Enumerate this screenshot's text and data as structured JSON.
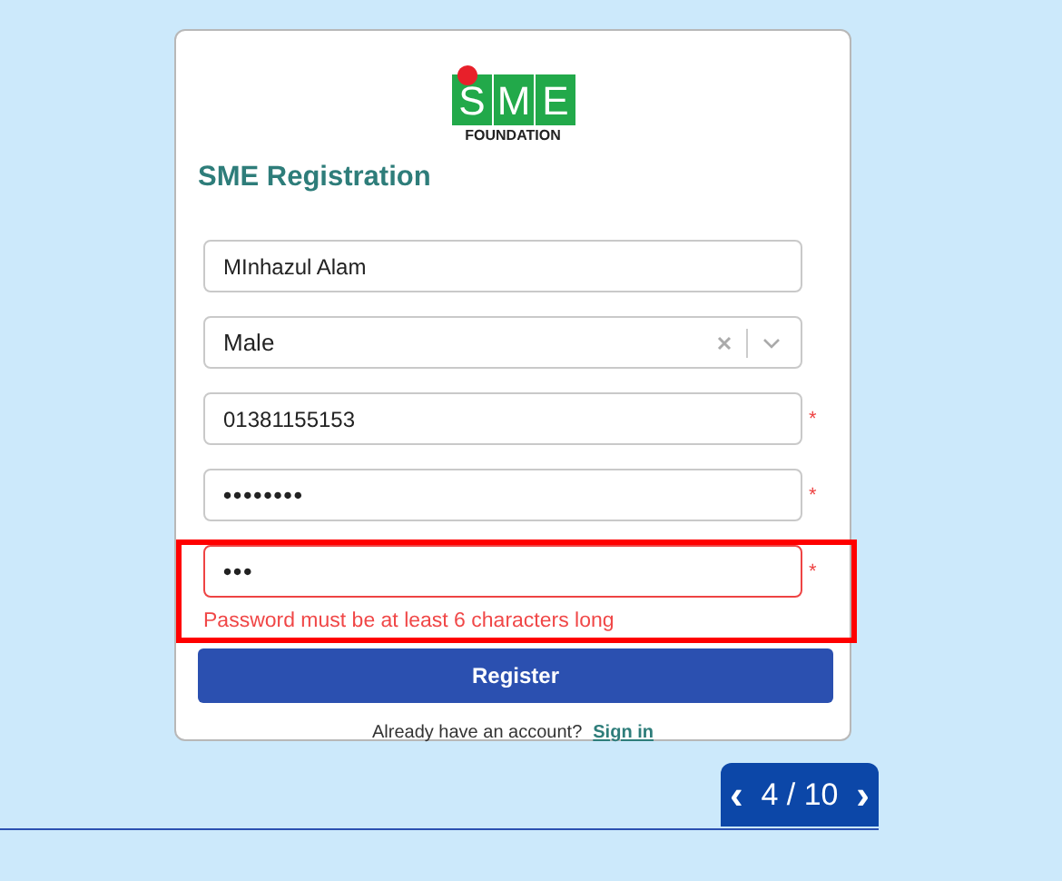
{
  "logo": {
    "letters": [
      "S",
      "M",
      "E"
    ],
    "tagline": "FOUNDATION"
  },
  "title": "SME Registration",
  "fields": [
    {
      "kind": "text",
      "value": "MInhazul Alam",
      "invalid": false,
      "highlighted": false
    },
    {
      "kind": "select",
      "value": "Male",
      "invalid": false,
      "highlighted": false
    },
    {
      "kind": "text",
      "value": "01381155153",
      "required_mark": "*",
      "invalid": false,
      "highlighted": false
    },
    {
      "kind": "password",
      "value": "••••••••",
      "required_mark": "*",
      "invalid": false,
      "highlighted": false
    },
    {
      "kind": "password",
      "value": "•••",
      "required_mark": "*",
      "invalid": true,
      "error": "Password must be at least 6 characters long",
      "highlighted": true
    }
  ],
  "submit": "Register",
  "signin": {
    "prompt": "Already have an account?",
    "link": "Sign in"
  },
  "pager": {
    "prev": "‹",
    "label": "4 / 10",
    "next": "›"
  }
}
